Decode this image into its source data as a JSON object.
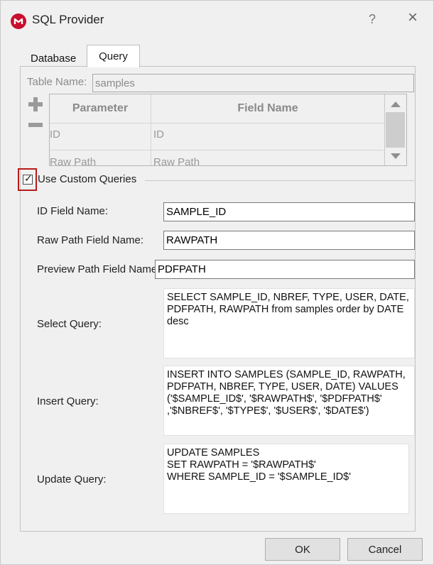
{
  "window": {
    "title": "SQL Provider",
    "help_glyph": "?",
    "close_glyph": "×"
  },
  "tabs": [
    {
      "label": "Database",
      "active": false
    },
    {
      "label": "Query",
      "active": true
    }
  ],
  "table_name": {
    "label": "Table Name:",
    "value": "samples"
  },
  "param_table": {
    "headers": [
      "Parameter",
      "Field Name"
    ],
    "rows": [
      [
        "ID",
        "ID"
      ],
      [
        "Raw Path",
        "Raw Path"
      ]
    ]
  },
  "custom_queries": {
    "checked": true,
    "check_glyph": "✓",
    "label": "Use Custom Queries"
  },
  "fields": {
    "id_field": {
      "label": "ID Field Name:",
      "value": "SAMPLE_ID"
    },
    "raw_path": {
      "label": "Raw Path Field Name:",
      "value": "RAWPATH"
    },
    "preview_path": {
      "label": "Preview Path Field Name:",
      "value": "PDFPATH"
    },
    "select_query": {
      "label": "Select Query:",
      "value": "SELECT SAMPLE_ID, NBREF, TYPE, USER, DATE,\nPDFPATH, RAWPATH from samples order by DATE\ndesc"
    },
    "insert_query": {
      "label": "Insert Query:",
      "value": "INSERT INTO SAMPLES (SAMPLE_ID, RAWPATH,\nPDFPATH, NBREF, TYPE, USER, DATE) VALUES\n('$SAMPLE_ID$', '$RAWPATH$', '$PDFPATH$'\n,'$NBREF$', '$TYPE$', '$USER$', '$DATE$')"
    },
    "update_query": {
      "label": "Update Query:",
      "value": "UPDATE SAMPLES\nSET RAWPATH = '$RAWPATH$'\nWHERE SAMPLE_ID = '$SAMPLE_ID$'"
    }
  },
  "buttons": {
    "ok": "OK",
    "cancel": "Cancel"
  },
  "colors": {
    "accent_red": "#c8102e",
    "highlight_border": "#b81c1c"
  }
}
